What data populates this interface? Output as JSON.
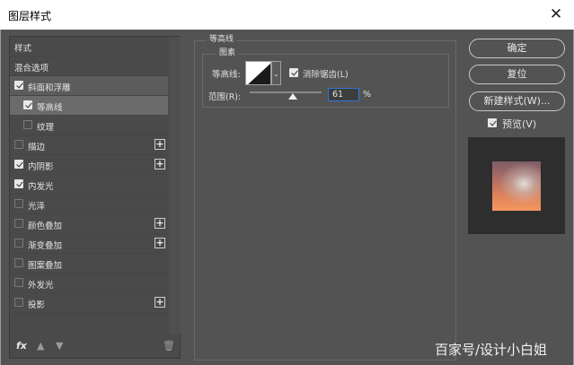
{
  "window": {
    "title": "图层样式"
  },
  "sidebar": {
    "items": [
      {
        "label": "样式",
        "has_checkbox": false,
        "checked": false,
        "has_plus": false,
        "selected": false,
        "indent": 0
      },
      {
        "label": "混合选项",
        "has_checkbox": false,
        "checked": false,
        "has_plus": false,
        "selected": false,
        "indent": 0
      },
      {
        "label": "斜面和浮雕",
        "has_checkbox": true,
        "checked": true,
        "has_plus": false,
        "selected": false,
        "indent": 0
      },
      {
        "label": "等高线",
        "has_checkbox": true,
        "checked": true,
        "has_plus": false,
        "selected": true,
        "indent": 1
      },
      {
        "label": "纹理",
        "has_checkbox": true,
        "checked": false,
        "has_plus": false,
        "selected": false,
        "indent": 1
      },
      {
        "label": "描边",
        "has_checkbox": true,
        "checked": false,
        "has_plus": true,
        "selected": false,
        "indent": 0
      },
      {
        "label": "内阴影",
        "has_checkbox": true,
        "checked": true,
        "has_plus": true,
        "selected": false,
        "indent": 0
      },
      {
        "label": "内发光",
        "has_checkbox": true,
        "checked": true,
        "has_plus": false,
        "selected": false,
        "indent": 0
      },
      {
        "label": "光泽",
        "has_checkbox": true,
        "checked": false,
        "has_plus": false,
        "selected": false,
        "indent": 0
      },
      {
        "label": "颜色叠加",
        "has_checkbox": true,
        "checked": false,
        "has_plus": true,
        "selected": false,
        "indent": 0
      },
      {
        "label": "渐变叠加",
        "has_checkbox": true,
        "checked": false,
        "has_plus": true,
        "selected": false,
        "indent": 0
      },
      {
        "label": "图案叠加",
        "has_checkbox": true,
        "checked": false,
        "has_plus": false,
        "selected": false,
        "indent": 0
      },
      {
        "label": "外发光",
        "has_checkbox": true,
        "checked": false,
        "has_plus": false,
        "selected": false,
        "indent": 0
      },
      {
        "label": "投影",
        "has_checkbox": true,
        "checked": false,
        "has_plus": true,
        "selected": false,
        "indent": 0
      }
    ],
    "bottom": {
      "fx": "fx",
      "up_icon": "arrow-up-icon",
      "down_icon": "arrow-down-icon",
      "trash_icon": "trash-icon"
    }
  },
  "contour_panel": {
    "group_title": "等高线",
    "subgroup_title": "图素",
    "contour_label": "等高线:",
    "antialias_label": "消除锯齿(L)",
    "antialias_checked": true,
    "range_label": "范围(R):",
    "range_value": "61",
    "range_unit": "%"
  },
  "buttons": {
    "ok": "确定",
    "reset": "复位",
    "new_style": "新建样式(W)...",
    "preview_label": "预览(V)",
    "preview_checked": true
  },
  "watermark": "百家号/设计小白姐",
  "colors": {
    "dialog_bg": "#535353",
    "selected_row": "#6b6b6b",
    "highlight_row": "#5c5c5c",
    "focus_border": "#2c7ad6"
  }
}
